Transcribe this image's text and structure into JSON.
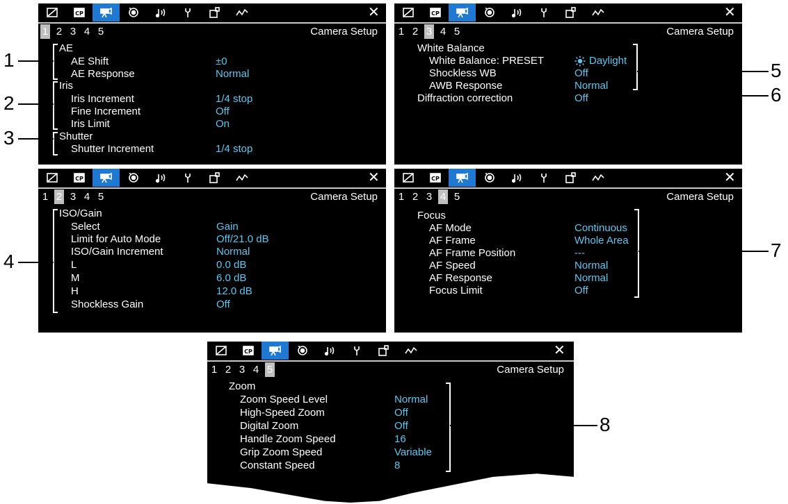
{
  "tab_icons": [
    "status-icon",
    "custom-picture-icon",
    "camera-icon",
    "recording-icon",
    "audio-icon",
    "maintenance-icon",
    "assignable-icon",
    "network-icon"
  ],
  "close_label": "✕",
  "page_numbers": [
    "1",
    "2",
    "3",
    "4",
    "5"
  ],
  "screen_title": "Camera Setup",
  "screens": {
    "p1": {
      "active_page": "1",
      "groups": [
        {
          "heading": "AE",
          "items": [
            {
              "label": "AE Shift",
              "value": "±0"
            },
            {
              "label": "AE Response",
              "value": "Normal"
            }
          ]
        },
        {
          "heading": "Iris",
          "items": [
            {
              "label": "Iris Increment",
              "value": "1/4 stop"
            },
            {
              "label": "Fine Increment",
              "value": "Off"
            },
            {
              "label": "Iris Limit",
              "value": "On"
            }
          ]
        },
        {
          "heading": "Shutter",
          "items": [
            {
              "label": "Shutter Increment",
              "value": "1/4 stop"
            }
          ]
        }
      ]
    },
    "p2": {
      "active_page": "2",
      "heading": "ISO/Gain",
      "items": [
        {
          "label": "Select",
          "value": "Gain"
        },
        {
          "label": "Limit for Auto Mode",
          "value": "Off/21.0 dB"
        },
        {
          "label": "ISO/Gain Increment",
          "value": "Normal"
        },
        {
          "label": "L",
          "value": "0.0 dB"
        },
        {
          "label": "M",
          "value": "6.0 dB"
        },
        {
          "label": "H",
          "value": "12.0 dB"
        },
        {
          "label": "Shockless Gain",
          "value": "Off"
        }
      ]
    },
    "p3": {
      "active_page": "3",
      "heading": "White Balance",
      "items": [
        {
          "label": "White Balance: PRESET",
          "value": "Daylight"
        },
        {
          "label": "Shockless WB",
          "value": "Off"
        },
        {
          "label": "AWB Response",
          "value": "Normal"
        }
      ],
      "extra": {
        "label": "Diffraction correction",
        "value": "Off"
      }
    },
    "p4": {
      "active_page": "4",
      "heading": "Focus",
      "items": [
        {
          "label": "AF Mode",
          "value": "Continuous"
        },
        {
          "label": "AF Frame",
          "value": "Whole Area"
        },
        {
          "label": "AF Frame Position",
          "value": "---"
        },
        {
          "label": "AF Speed",
          "value": "Normal"
        },
        {
          "label": "AF Response",
          "value": "Normal"
        },
        {
          "label": "Focus Limit",
          "value": "Off"
        }
      ]
    },
    "p5": {
      "active_page": "5",
      "heading": "Zoom",
      "items": [
        {
          "label": "Zoom Speed Level",
          "value": "Normal"
        },
        {
          "label": "High-Speed Zoom",
          "value": "Off"
        },
        {
          "label": "Digital Zoom",
          "value": "Off"
        },
        {
          "label": "Handle Zoom Speed",
          "value": "16"
        },
        {
          "label": "Grip Zoom Speed",
          "value": "Variable"
        },
        {
          "label": "Constant Speed",
          "value": "8"
        }
      ]
    }
  },
  "callouts": [
    "1",
    "2",
    "3",
    "4",
    "5",
    "6",
    "7",
    "8"
  ],
  "colors": {
    "value": "#5cc8f2",
    "active_tab": "#1f78d1",
    "active_page_bg": "#bfbfbf"
  }
}
